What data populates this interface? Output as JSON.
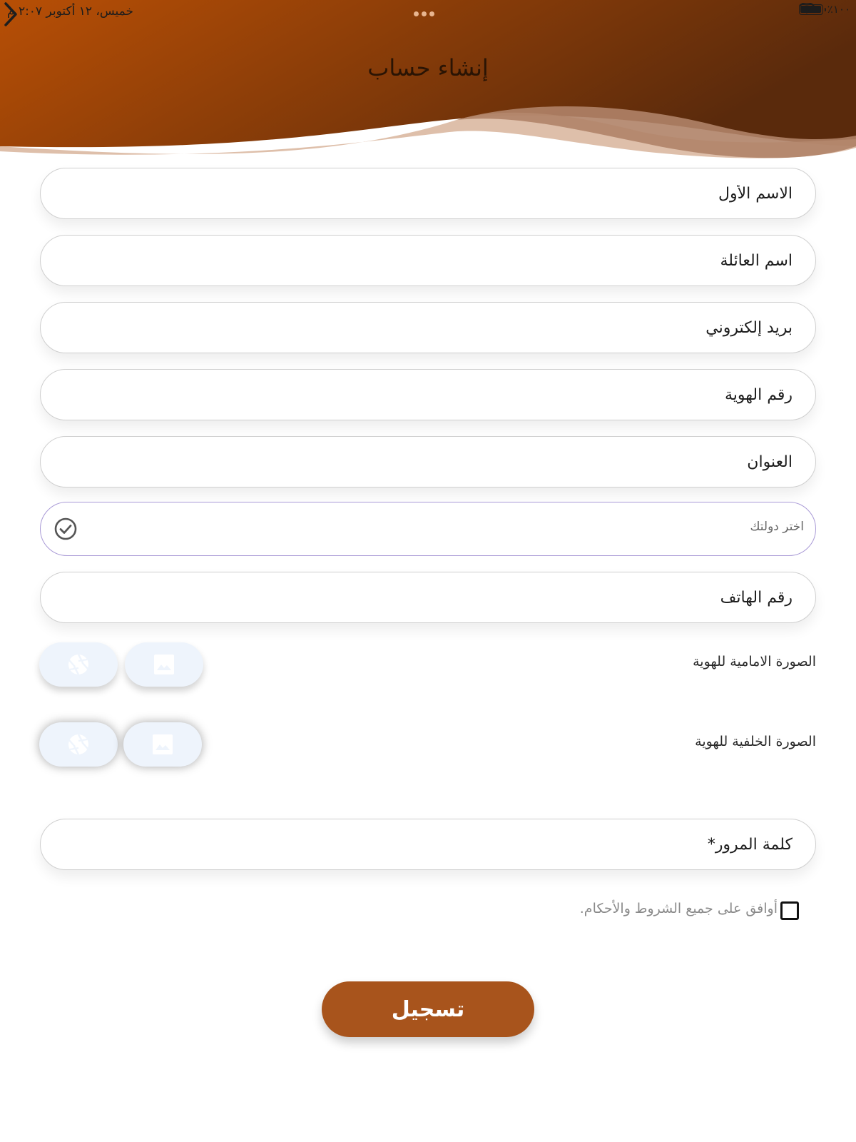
{
  "status_bar": {
    "datetime": "خميس، ١٢ أكتوبر  ٢:٠٧ م",
    "battery": "٪١٠٠"
  },
  "header": {
    "title": "إنشاء حساب"
  },
  "form": {
    "first_name_placeholder": "الاسم الأول",
    "family_name_placeholder": "اسم العائلة",
    "email_placeholder": "بريد إلكتروني",
    "id_number_placeholder": "رقم الهوية",
    "address_placeholder": "العنوان",
    "country_placeholder": "اختر دولتك",
    "phone_placeholder": "رقم الهاتف",
    "front_id_label": "الصورة الامامية للهوية",
    "back_id_label": "الصورة الخلفية للهوية",
    "password_placeholder": "كلمة المرور*",
    "terms_label": "أوافق على جميع الشروط والأحكام.",
    "register_label": "تسجيل"
  },
  "icons": {
    "back": "chevron-right-icon",
    "country_check": "check-circle-icon",
    "camera": "camera-shutter-icon",
    "gallery": "image-icon"
  },
  "colors": {
    "accent": "#a8541c",
    "header_start": "#b34f06",
    "header_end": "#5b2b0c"
  }
}
